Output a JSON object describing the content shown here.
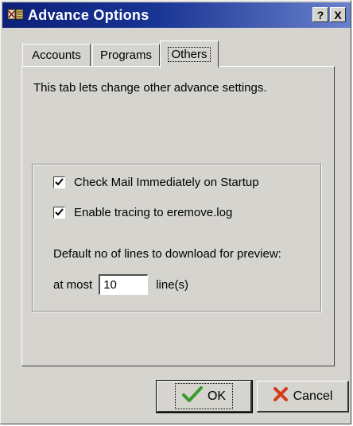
{
  "window": {
    "title": "Advance Options",
    "help_label": "?",
    "close_label": "X"
  },
  "tabs": [
    {
      "label": "Accounts",
      "active": false
    },
    {
      "label": "Programs",
      "active": false
    },
    {
      "label": "Others",
      "active": true
    }
  ],
  "panel": {
    "description": "This tab lets change other advance settings.",
    "options": [
      {
        "label": "Check Mail Immediately on Startup",
        "checked": true
      },
      {
        "label": "Enable tracing to eremove.log",
        "checked": true
      }
    ],
    "preview_note": "Default no of lines to download for preview:",
    "at_most_label": "at most",
    "lines_value": "10",
    "lines_unit": "line(s)"
  },
  "buttons": {
    "ok_label": "OK",
    "cancel_label": "Cancel"
  },
  "colors": {
    "titlebar_start": "#0c1f7a",
    "titlebar_end": "#6a82cc",
    "face": "#d5d4cf",
    "ok_check": "#3a9a2a",
    "cancel_x": "#d63a1a"
  },
  "icons": {
    "app": "app-icon",
    "ok": "checkmark-icon",
    "cancel": "x-icon"
  }
}
